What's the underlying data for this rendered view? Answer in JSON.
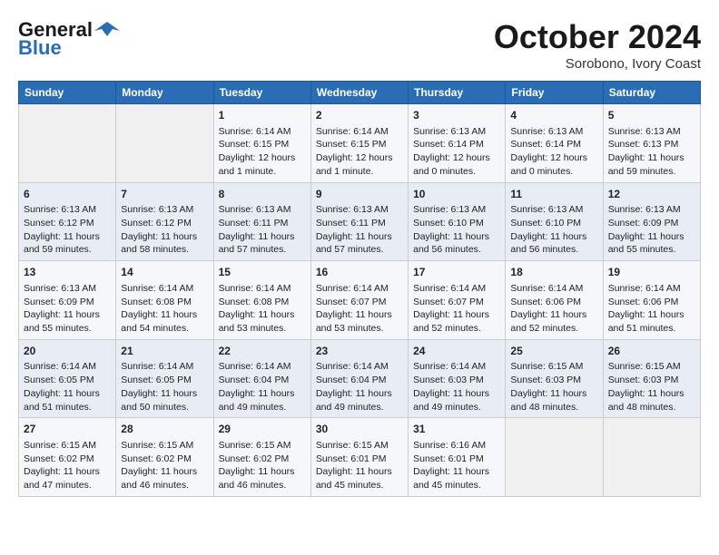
{
  "header": {
    "logo_line1": "General",
    "logo_line2": "Blue",
    "month": "October 2024",
    "location": "Sorobono, Ivory Coast"
  },
  "weekdays": [
    "Sunday",
    "Monday",
    "Tuesday",
    "Wednesday",
    "Thursday",
    "Friday",
    "Saturday"
  ],
  "weeks": [
    [
      {
        "day": "",
        "content": ""
      },
      {
        "day": "",
        "content": ""
      },
      {
        "day": "1",
        "content": "Sunrise: 6:14 AM\nSunset: 6:15 PM\nDaylight: 12 hours and 1 minute."
      },
      {
        "day": "2",
        "content": "Sunrise: 6:14 AM\nSunset: 6:15 PM\nDaylight: 12 hours and 1 minute."
      },
      {
        "day": "3",
        "content": "Sunrise: 6:13 AM\nSunset: 6:14 PM\nDaylight: 12 hours and 0 minutes."
      },
      {
        "day": "4",
        "content": "Sunrise: 6:13 AM\nSunset: 6:14 PM\nDaylight: 12 hours and 0 minutes."
      },
      {
        "day": "5",
        "content": "Sunrise: 6:13 AM\nSunset: 6:13 PM\nDaylight: 11 hours and 59 minutes."
      }
    ],
    [
      {
        "day": "6",
        "content": "Sunrise: 6:13 AM\nSunset: 6:12 PM\nDaylight: 11 hours and 59 minutes."
      },
      {
        "day": "7",
        "content": "Sunrise: 6:13 AM\nSunset: 6:12 PM\nDaylight: 11 hours and 58 minutes."
      },
      {
        "day": "8",
        "content": "Sunrise: 6:13 AM\nSunset: 6:11 PM\nDaylight: 11 hours and 57 minutes."
      },
      {
        "day": "9",
        "content": "Sunrise: 6:13 AM\nSunset: 6:11 PM\nDaylight: 11 hours and 57 minutes."
      },
      {
        "day": "10",
        "content": "Sunrise: 6:13 AM\nSunset: 6:10 PM\nDaylight: 11 hours and 56 minutes."
      },
      {
        "day": "11",
        "content": "Sunrise: 6:13 AM\nSunset: 6:10 PM\nDaylight: 11 hours and 56 minutes."
      },
      {
        "day": "12",
        "content": "Sunrise: 6:13 AM\nSunset: 6:09 PM\nDaylight: 11 hours and 55 minutes."
      }
    ],
    [
      {
        "day": "13",
        "content": "Sunrise: 6:13 AM\nSunset: 6:09 PM\nDaylight: 11 hours and 55 minutes."
      },
      {
        "day": "14",
        "content": "Sunrise: 6:14 AM\nSunset: 6:08 PM\nDaylight: 11 hours and 54 minutes."
      },
      {
        "day": "15",
        "content": "Sunrise: 6:14 AM\nSunset: 6:08 PM\nDaylight: 11 hours and 53 minutes."
      },
      {
        "day": "16",
        "content": "Sunrise: 6:14 AM\nSunset: 6:07 PM\nDaylight: 11 hours and 53 minutes."
      },
      {
        "day": "17",
        "content": "Sunrise: 6:14 AM\nSunset: 6:07 PM\nDaylight: 11 hours and 52 minutes."
      },
      {
        "day": "18",
        "content": "Sunrise: 6:14 AM\nSunset: 6:06 PM\nDaylight: 11 hours and 52 minutes."
      },
      {
        "day": "19",
        "content": "Sunrise: 6:14 AM\nSunset: 6:06 PM\nDaylight: 11 hours and 51 minutes."
      }
    ],
    [
      {
        "day": "20",
        "content": "Sunrise: 6:14 AM\nSunset: 6:05 PM\nDaylight: 11 hours and 51 minutes."
      },
      {
        "day": "21",
        "content": "Sunrise: 6:14 AM\nSunset: 6:05 PM\nDaylight: 11 hours and 50 minutes."
      },
      {
        "day": "22",
        "content": "Sunrise: 6:14 AM\nSunset: 6:04 PM\nDaylight: 11 hours and 49 minutes."
      },
      {
        "day": "23",
        "content": "Sunrise: 6:14 AM\nSunset: 6:04 PM\nDaylight: 11 hours and 49 minutes."
      },
      {
        "day": "24",
        "content": "Sunrise: 6:14 AM\nSunset: 6:03 PM\nDaylight: 11 hours and 49 minutes."
      },
      {
        "day": "25",
        "content": "Sunrise: 6:15 AM\nSunset: 6:03 PM\nDaylight: 11 hours and 48 minutes."
      },
      {
        "day": "26",
        "content": "Sunrise: 6:15 AM\nSunset: 6:03 PM\nDaylight: 11 hours and 48 minutes."
      }
    ],
    [
      {
        "day": "27",
        "content": "Sunrise: 6:15 AM\nSunset: 6:02 PM\nDaylight: 11 hours and 47 minutes."
      },
      {
        "day": "28",
        "content": "Sunrise: 6:15 AM\nSunset: 6:02 PM\nDaylight: 11 hours and 46 minutes."
      },
      {
        "day": "29",
        "content": "Sunrise: 6:15 AM\nSunset: 6:02 PM\nDaylight: 11 hours and 46 minutes."
      },
      {
        "day": "30",
        "content": "Sunrise: 6:15 AM\nSunset: 6:01 PM\nDaylight: 11 hours and 45 minutes."
      },
      {
        "day": "31",
        "content": "Sunrise: 6:16 AM\nSunset: 6:01 PM\nDaylight: 11 hours and 45 minutes."
      },
      {
        "day": "",
        "content": ""
      },
      {
        "day": "",
        "content": ""
      }
    ]
  ]
}
